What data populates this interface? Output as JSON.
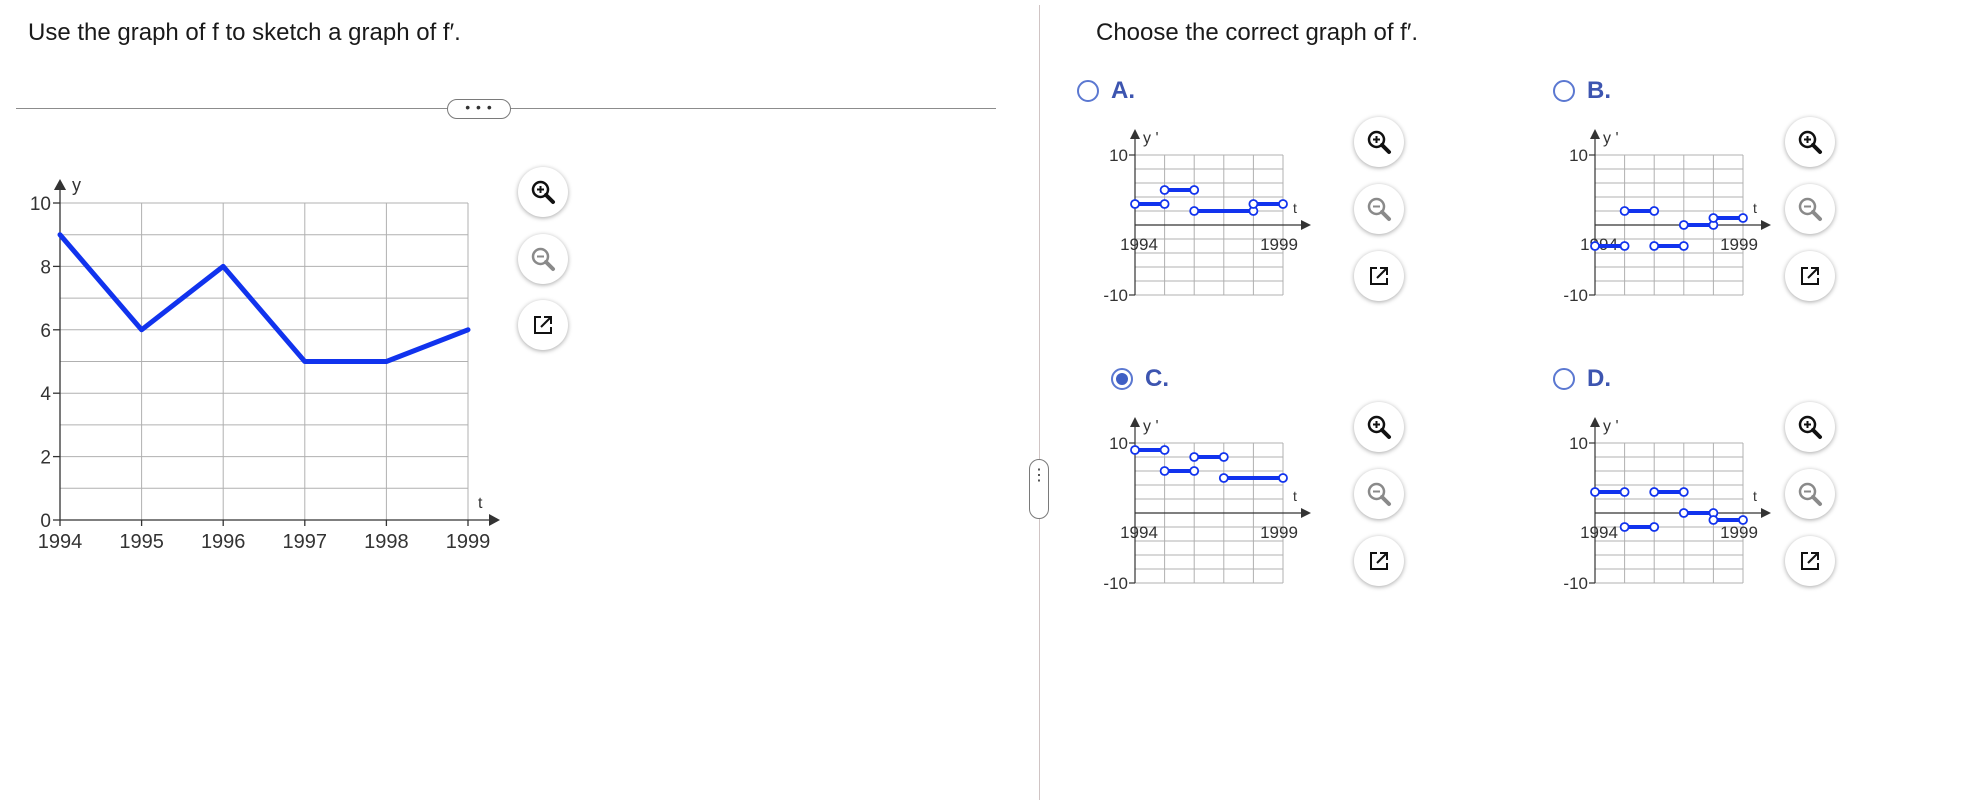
{
  "question": {
    "text": "Use the graph of f to sketch a graph of f′."
  },
  "answer_prompt": {
    "text": "Choose the correct graph of f′."
  },
  "ui": {
    "more_pill_label": "• • •",
    "split_handle_label": "⋮"
  },
  "icons": {
    "zoom_in": "zoom-in-icon",
    "zoom_out": "zoom-out-icon",
    "popout": "external-link-icon",
    "radio": "radio-button"
  },
  "colors": {
    "curve": "#1133ee",
    "grid": "#b0b0b0",
    "option_letter": "#3d55b0",
    "radio": "#5b78d1"
  },
  "options": [
    {
      "letter": "A.",
      "selected": false
    },
    {
      "letter": "B.",
      "selected": false
    },
    {
      "letter": "C.",
      "selected": true
    },
    {
      "letter": "D.",
      "selected": false
    }
  ],
  "chart_data": [
    {
      "id": "main",
      "type": "line",
      "title": "",
      "xlabel": "t",
      "ylabel": "y",
      "xlim": [
        1994,
        1999
      ],
      "ylim": [
        0,
        10
      ],
      "x_ticks": [
        "1994",
        "1995",
        "1996",
        "1997",
        "1998",
        "1999"
      ],
      "y_ticks": [
        "0",
        "2",
        "4",
        "6",
        "8",
        "10"
      ],
      "grid": true,
      "series": [
        {
          "x": [
            1994,
            1995,
            1996,
            1997,
            1998,
            1999
          ],
          "y": [
            9,
            6,
            8,
            5,
            5,
            6
          ]
        }
      ]
    },
    {
      "id": "A",
      "type": "line",
      "xlabel": "t",
      "ylabel": "y '",
      "xlim": [
        1994,
        1999
      ],
      "ylim": [
        -10,
        10
      ],
      "x_ticks": [
        "1994",
        "1999"
      ],
      "y_ticks": [
        "10",
        "-10"
      ],
      "grid": true,
      "segments": [
        {
          "x": [
            1994,
            1995
          ],
          "y": [
            3,
            3
          ]
        },
        {
          "x": [
            1995,
            1996
          ],
          "y": [
            5,
            5
          ]
        },
        {
          "x": [
            1996,
            1998
          ],
          "y": [
            2,
            2
          ]
        },
        {
          "x": [
            1998,
            1999
          ],
          "y": [
            3,
            3
          ]
        }
      ]
    },
    {
      "id": "B",
      "type": "line",
      "xlabel": "t",
      "ylabel": "y '",
      "xlim": [
        1994,
        1999
      ],
      "ylim": [
        -10,
        10
      ],
      "x_ticks": [
        "1994",
        "1999"
      ],
      "y_ticks": [
        "10",
        "-10"
      ],
      "grid": true,
      "segments": [
        {
          "x": [
            1994,
            1995
          ],
          "y": [
            -3,
            -3
          ]
        },
        {
          "x": [
            1995,
            1996
          ],
          "y": [
            2,
            2
          ]
        },
        {
          "x": [
            1996,
            1997
          ],
          "y": [
            -3,
            -3
          ]
        },
        {
          "x": [
            1997,
            1998
          ],
          "y": [
            0,
            0
          ]
        },
        {
          "x": [
            1998,
            1999
          ],
          "y": [
            1,
            1
          ]
        }
      ]
    },
    {
      "id": "C",
      "type": "line",
      "xlabel": "t",
      "ylabel": "y '",
      "xlim": [
        1994,
        1999
      ],
      "ylim": [
        -10,
        10
      ],
      "x_ticks": [
        "1994",
        "1999"
      ],
      "y_ticks": [
        "10",
        "-10"
      ],
      "grid": true,
      "segments": [
        {
          "x": [
            1994,
            1995
          ],
          "y": [
            9,
            9
          ]
        },
        {
          "x": [
            1995,
            1996
          ],
          "y": [
            6,
            6
          ]
        },
        {
          "x": [
            1996,
            1997
          ],
          "y": [
            8,
            8
          ]
        },
        {
          "x": [
            1997,
            1999
          ],
          "y": [
            5,
            5
          ]
        }
      ]
    },
    {
      "id": "D",
      "type": "line",
      "xlabel": "t",
      "ylabel": "y '",
      "xlim": [
        1994,
        1999
      ],
      "ylim": [
        -10,
        10
      ],
      "x_ticks": [
        "1994",
        "1999"
      ],
      "y_ticks": [
        "10",
        "-10"
      ],
      "grid": true,
      "segments": [
        {
          "x": [
            1994,
            1995
          ],
          "y": [
            3,
            3
          ]
        },
        {
          "x": [
            1995,
            1996
          ],
          "y": [
            -2,
            -2
          ]
        },
        {
          "x": [
            1996,
            1997
          ],
          "y": [
            3,
            3
          ]
        },
        {
          "x": [
            1997,
            1998
          ],
          "y": [
            0,
            0
          ]
        },
        {
          "x": [
            1998,
            1999
          ],
          "y": [
            -1,
            -1
          ]
        }
      ]
    }
  ]
}
